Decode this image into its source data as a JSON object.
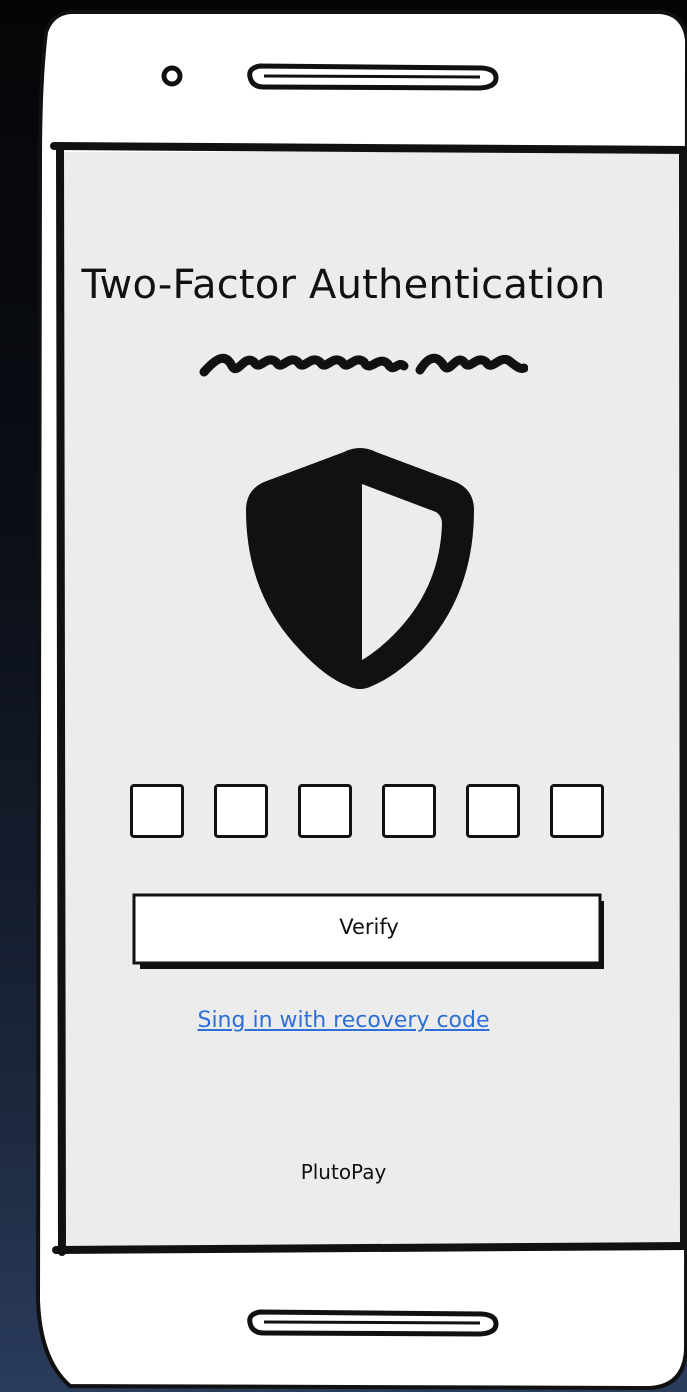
{
  "screen": {
    "title": "Two-Factor Authentication",
    "code_inputs": [
      "",
      "",
      "",
      "",
      "",
      ""
    ],
    "verify_label": "Verify",
    "recovery_link": "Sing in with recovery code",
    "brand": "PlutoPay"
  },
  "icons": {
    "shield": "shield-half-icon",
    "camera": "camera-dot-icon",
    "speaker": "earpiece-speaker-icon",
    "home": "home-bar-icon"
  },
  "colors": {
    "screen_bg": "#ececec",
    "link": "#2d6fd6",
    "ink": "#111111"
  }
}
